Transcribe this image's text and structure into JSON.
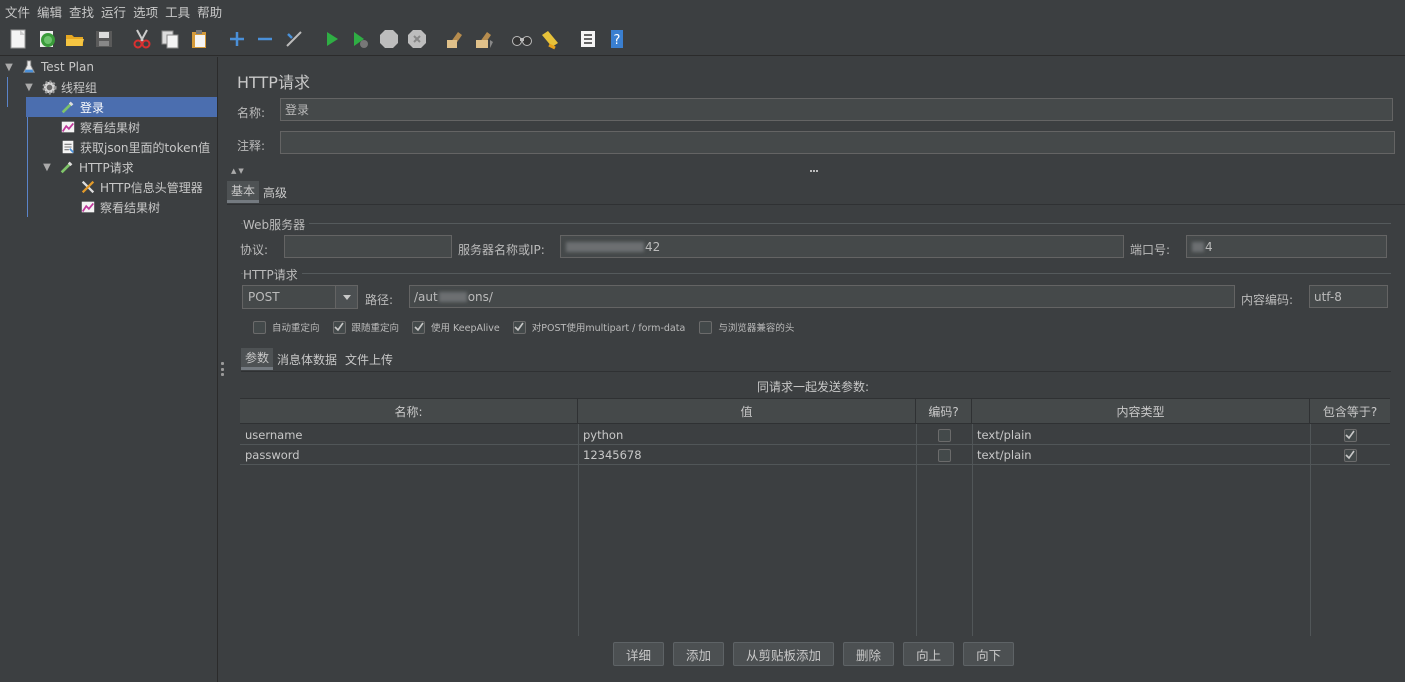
{
  "menu": [
    "文件",
    "编辑",
    "查找",
    "运行",
    "选项",
    "工具",
    "帮助"
  ],
  "toolbar": [
    {
      "name": "new-icon"
    },
    {
      "name": "templates-icon"
    },
    {
      "name": "open-icon"
    },
    {
      "name": "save-icon"
    },
    {
      "name": "cut-icon"
    },
    {
      "name": "copy-icon"
    },
    {
      "name": "paste-icon"
    },
    {
      "name": "expand-icon"
    },
    {
      "name": "collapse-icon"
    },
    {
      "name": "toggle-icon"
    },
    {
      "name": "start-icon"
    },
    {
      "name": "start-no-pause-icon"
    },
    {
      "name": "stop-icon"
    },
    {
      "name": "shutdown-icon"
    },
    {
      "name": "clear-icon"
    },
    {
      "name": "clear-all-icon"
    },
    {
      "name": "search-icon"
    },
    {
      "name": "reset-search-icon"
    },
    {
      "name": "function-helper-icon"
    },
    {
      "name": "help-icon"
    }
  ],
  "tree": {
    "items": [
      {
        "label": "Test Plan",
        "icon": "flask-icon"
      },
      {
        "label": "线程组",
        "icon": "gear-icon"
      },
      {
        "label": "登录",
        "icon": "sampler-pipette-icon"
      },
      {
        "label": "察看结果树",
        "icon": "result-tree-icon"
      },
      {
        "label": "获取json里面的token值",
        "icon": "json-extractor-icon"
      },
      {
        "label": "HTTP请求",
        "icon": "sampler-pipette-icon"
      },
      {
        "label": "HTTP信息头管理器",
        "icon": "tools-icon"
      },
      {
        "label": "察看结果树",
        "icon": "result-tree-icon"
      }
    ]
  },
  "panel": {
    "title": "HTTP请求",
    "name_label": "名称:",
    "name_value": "登录",
    "comment_label": "注释:",
    "comment_value": "",
    "tabs": [
      "基本",
      "高级"
    ],
    "web_server": {
      "group_title": "Web服务器",
      "protocol_label": "协议:",
      "protocol_value": "",
      "server_label": "服务器名称或IP:",
      "server_value_suffix": "42",
      "port_label": "端口号:",
      "port_value_suffix": "4"
    },
    "http_request": {
      "group_title": "HTTP请求",
      "method": "POST",
      "path_label": "路径:",
      "path_prefix": "/aut",
      "path_suffix": "ons/",
      "encoding_label": "内容编码:",
      "encoding_value": "utf-8"
    },
    "options": [
      {
        "label": "自动重定向",
        "checked": false
      },
      {
        "label": "跟随重定向",
        "checked": true
      },
      {
        "label": "使用 KeepAlive",
        "checked": true
      },
      {
        "label": "对POST使用multipart / form-data",
        "checked": true
      },
      {
        "label": "与浏览器兼容的头",
        "checked": false
      }
    ],
    "sub_tabs": [
      "参数",
      "消息体数据",
      "文件上传"
    ],
    "params_caption": "同请求一起发送参数:",
    "table": {
      "headers": [
        "名称:",
        "值",
        "编码?",
        "内容类型",
        "包含等于?"
      ],
      "rows": [
        {
          "name": "username",
          "value": "python",
          "encode": false,
          "content_type": "text/plain",
          "include_equals": true
        },
        {
          "name": "password",
          "value": "12345678",
          "encode": false,
          "content_type": "text/plain",
          "include_equals": true
        }
      ]
    },
    "buttons": [
      "详细",
      "添加",
      "从剪贴板添加",
      "删除",
      "向上",
      "向下"
    ]
  }
}
